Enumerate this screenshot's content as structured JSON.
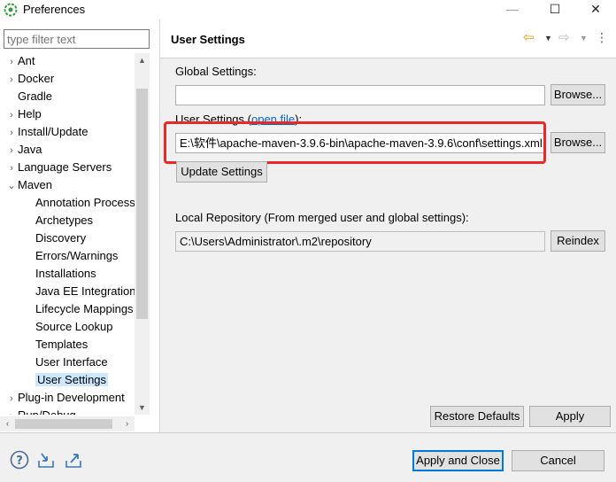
{
  "window": {
    "title": "Preferences",
    "minimize": "—",
    "maximize": "☐",
    "close": "✕"
  },
  "filter": {
    "placeholder": "type filter text"
  },
  "tree": [
    {
      "label": "Ant",
      "twisty": ">",
      "indent": 0
    },
    {
      "label": "Docker",
      "twisty": ">",
      "indent": 0
    },
    {
      "label": "Gradle",
      "twisty": "",
      "indent": 0
    },
    {
      "label": "Help",
      "twisty": ">",
      "indent": 0
    },
    {
      "label": "Install/Update",
      "twisty": ">",
      "indent": 0
    },
    {
      "label": "Java",
      "twisty": ">",
      "indent": 0
    },
    {
      "label": "Language Servers",
      "twisty": ">",
      "indent": 0
    },
    {
      "label": "Maven",
      "twisty": "v",
      "indent": 0
    },
    {
      "label": "Annotation Process",
      "twisty": "",
      "indent": 1
    },
    {
      "label": "Archetypes",
      "twisty": "",
      "indent": 1
    },
    {
      "label": "Discovery",
      "twisty": "",
      "indent": 1
    },
    {
      "label": "Errors/Warnings",
      "twisty": "",
      "indent": 1
    },
    {
      "label": "Installations",
      "twisty": "",
      "indent": 1
    },
    {
      "label": "Java EE Integration",
      "twisty": "",
      "indent": 1
    },
    {
      "label": "Lifecycle Mappings",
      "twisty": "",
      "indent": 1
    },
    {
      "label": "Source Lookup",
      "twisty": "",
      "indent": 1
    },
    {
      "label": "Templates",
      "twisty": "",
      "indent": 1
    },
    {
      "label": "User Interface",
      "twisty": "",
      "indent": 1
    },
    {
      "label": "User Settings",
      "twisty": "",
      "indent": 1,
      "selected": true
    },
    {
      "label": "Plug-in Development",
      "twisty": ">",
      "indent": 0
    },
    {
      "label": "Run/Debug",
      "twisty": ">",
      "indent": 0
    }
  ],
  "page": {
    "title": "User Settings",
    "global_label": "Global Settings:",
    "global_value": "",
    "browse_label": "Browse...",
    "user_label_prefix": "User Settings (",
    "user_label_link": "open file",
    "user_label_suffix": "):",
    "user_value": "E:\\软件\\apache-maven-3.9.6-bin\\apache-maven-3.9.6\\conf\\settings.xml",
    "update_label": "Update Settings",
    "local_label": "Local Repository (From merged user and global settings):",
    "local_value": "C:\\Users\\Administrator\\.m2\\repository",
    "reindex_label": "Reindex",
    "restore_label": "Restore Defaults",
    "apply_label": "Apply"
  },
  "footer": {
    "apply_close_label": "Apply and Close",
    "cancel_label": "Cancel"
  },
  "colors": {
    "highlight": "#e8292a",
    "selection": "#cce8ff",
    "accent": "#0078d7"
  }
}
